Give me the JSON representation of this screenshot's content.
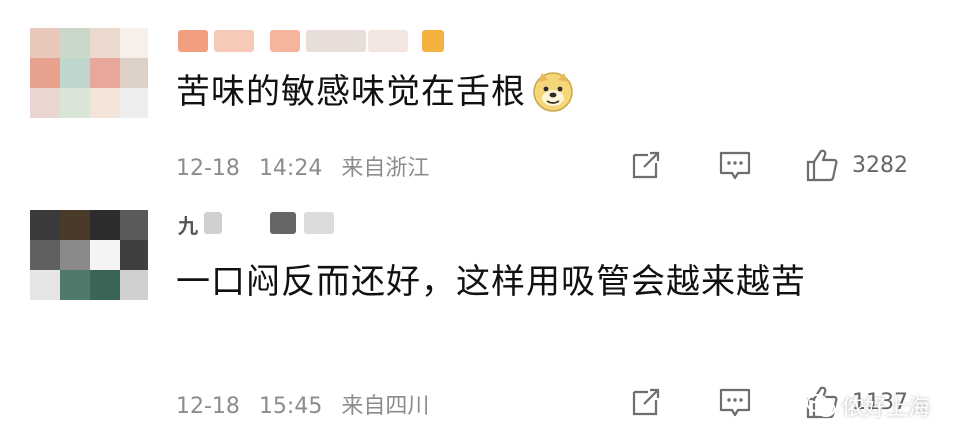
{
  "comments": [
    {
      "avatar_colors": [
        "#e9c7bb",
        "#c9d8c8",
        "#ecd9cd",
        "#f7f0ea",
        "#e8a08f",
        "#bfd6cd",
        "#e9a69b",
        "#ddd0c6",
        "#ead6d0",
        "#d9e5d7",
        "#f2e4d9",
        "#eee"
      ],
      "username_colors": [
        "#f29f80",
        "#f7c9b7",
        "#f6b49c",
        "#e8ddd9",
        "#f3e5e0",
        "#f4b13f"
      ],
      "text": "苦味的敏感味觉在舌根",
      "emoji": "doge-emoji",
      "date": "12-18",
      "time": "14:24",
      "location": "来自浙江",
      "like_count": "3282"
    },
    {
      "avatar_colors": [
        "#3a3a3a",
        "#4a3a2a",
        "#2d2d2d",
        "#5a5a5a",
        "#606060",
        "#8a8a8a",
        "#f4f4f4",
        "#3f3f3f",
        "#e6e6e6",
        "#4f7a6b",
        "#3a6458",
        "#cfcfcf"
      ],
      "username_hint": "九",
      "username_colors": [
        "#cfcfcf",
        "#666666",
        "#dcdcdc"
      ],
      "text": "一口闷反而还好，这样用吸管会越来越苦",
      "date": "12-18",
      "time": "15:45",
      "location": "来自四川",
      "like_count": "1137"
    }
  ],
  "icons": {
    "share": "share-icon",
    "reply": "reply-icon",
    "like": "thumbs-up-icon",
    "watermark": "wechat-icon"
  },
  "watermark_text": "侬好上海",
  "colors": {
    "meta_text": "#8c8c8c",
    "icon": "#6e6e6e"
  }
}
